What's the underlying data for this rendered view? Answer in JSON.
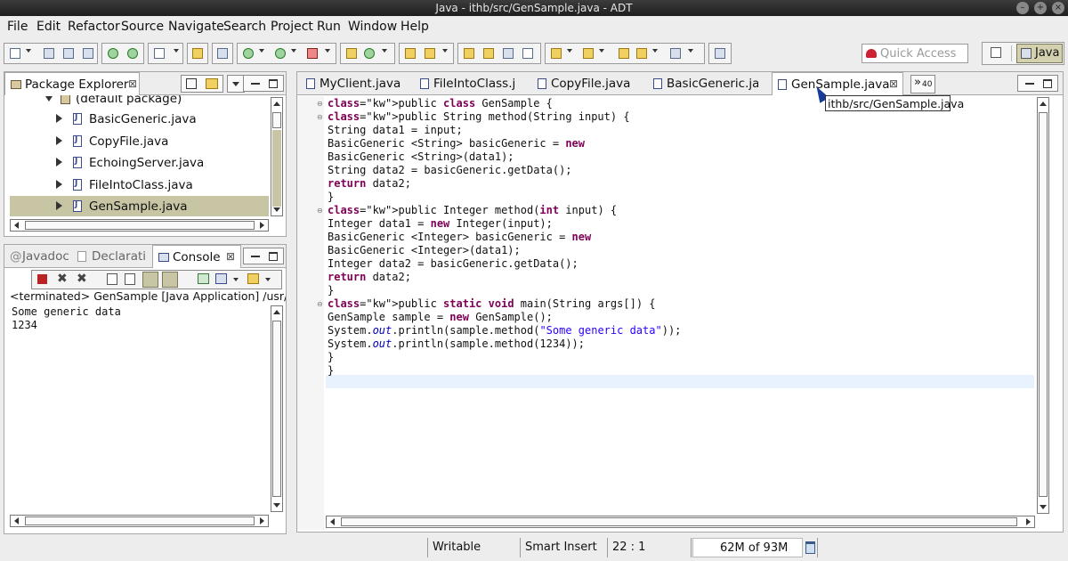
{
  "window": {
    "title": "Java - ithb/src/GenSample.java - ADT"
  },
  "menu": [
    "File",
    "Edit",
    "Refactor",
    "Source",
    "Navigate",
    "Search",
    "Project",
    "Run",
    "Window",
    "Help"
  ],
  "toolbar": {
    "quick_access_placeholder": "Quick Access",
    "perspective": "Java"
  },
  "package_explorer": {
    "tab_label": "Package Explorer",
    "items": [
      {
        "label": "(default package)"
      },
      {
        "label": "BasicGeneric.java"
      },
      {
        "label": "CopyFile.java"
      },
      {
        "label": "EchoingServer.java"
      },
      {
        "label": "FileIntoClass.java"
      },
      {
        "label": "GenSample.java",
        "selected": true
      }
    ]
  },
  "bottom_panel": {
    "tabs": [
      {
        "label": "Javadoc"
      },
      {
        "label": "Declarati"
      },
      {
        "label": "Console",
        "active": true
      }
    ],
    "terminated_line": "<terminated> GenSample [Java Application] /usr/lib/jvm",
    "output": [
      "Some generic data",
      "1234"
    ]
  },
  "editor": {
    "tabs": [
      {
        "label": "MyClient.java"
      },
      {
        "label": "FileIntoClass.j"
      },
      {
        "label": "CopyFile.java"
      },
      {
        "label": "BasicGeneric.ja"
      },
      {
        "label": "GenSample.java",
        "active": true
      }
    ],
    "overflow_label": "»",
    "overflow_count": "40",
    "tooltip": "ithb/src/GenSample.java",
    "code_lines": [
      "public class GenSample {",
      "public String method(String input) {",
      "String data1 = input;",
      "BasicGeneric <String> basicGeneric = new",
      "BasicGeneric <String>(data1);",
      "String data2 = basicGeneric.getData();",
      "return data2;",
      "}",
      "public Integer method(int input) {",
      "Integer data1 = new Integer(input);",
      "BasicGeneric <Integer> basicGeneric = new",
      "BasicGeneric <Integer>(data1);",
      "Integer data2 = basicGeneric.getData();",
      "return data2;",
      "}",
      "public static void main(String args[]) {",
      "GenSample sample = new GenSample();",
      "System.out.println(sample.method(\"Some generic data\"));",
      "System.out.println(sample.method(1234));",
      "}",
      "}",
      ""
    ]
  },
  "status": {
    "writable": "Writable",
    "insert_mode": "Smart Insert",
    "position": "22 : 1",
    "heap": "62M of 93M"
  }
}
